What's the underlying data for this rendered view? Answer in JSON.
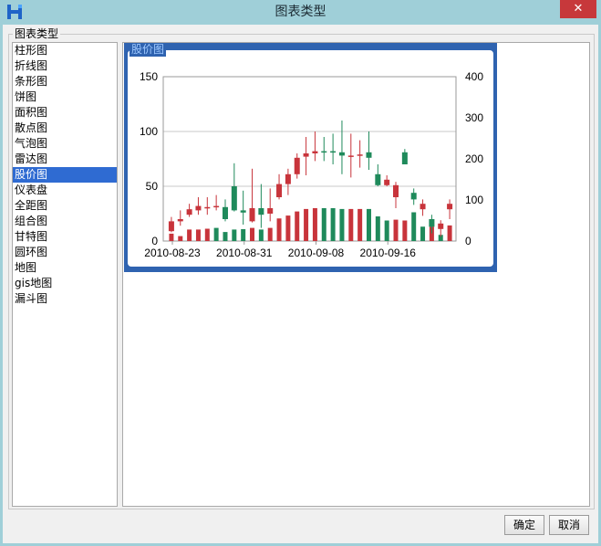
{
  "window": {
    "title": "图表类型",
    "close_symbol": "✕"
  },
  "group": {
    "label": "图表类型"
  },
  "chart_types": [
    {
      "label": "柱形图"
    },
    {
      "label": "折线图"
    },
    {
      "label": "条形图"
    },
    {
      "label": "饼图"
    },
    {
      "label": "面积图"
    },
    {
      "label": "散点图"
    },
    {
      "label": "气泡图"
    },
    {
      "label": "雷达图"
    },
    {
      "label": "股价图",
      "selected": true
    },
    {
      "label": "仪表盘"
    },
    {
      "label": "全距图"
    },
    {
      "label": "组合图"
    },
    {
      "label": "甘特图"
    },
    {
      "label": "圆环图"
    },
    {
      "label": "地图"
    },
    {
      "label": "gis地图"
    },
    {
      "label": "漏斗图"
    }
  ],
  "preview": {
    "label": "股价图"
  },
  "chart_data": {
    "type": "candlestick",
    "x_tick_labels": [
      "2010-08-23",
      "2010-08-31",
      "2010-09-08",
      "2010-09-16"
    ],
    "y_left": {
      "min": 0,
      "max": 150,
      "ticks": [
        0,
        50,
        100,
        150
      ]
    },
    "y_right": {
      "min": 0,
      "max": 400,
      "ticks": [
        0,
        100,
        200,
        300,
        400
      ]
    },
    "up_color": "#c8343b",
    "down_color": "#1f8a5b",
    "grid": true,
    "candles": [
      {
        "o": 9,
        "c": 18,
        "h": 22,
        "l": 8,
        "up": true
      },
      {
        "o": 18,
        "c": 20,
        "h": 28,
        "l": 14,
        "up": true
      },
      {
        "o": 24,
        "c": 29,
        "h": 34,
        "l": 22,
        "up": true
      },
      {
        "o": 28,
        "c": 32,
        "h": 40,
        "l": 24,
        "up": true
      },
      {
        "o": 30,
        "c": 31,
        "h": 40,
        "l": 24,
        "up": true
      },
      {
        "o": 31,
        "c": 32,
        "h": 42,
        "l": 28,
        "up": true
      },
      {
        "o": 31,
        "c": 20,
        "h": 38,
        "l": 18,
        "up": false
      },
      {
        "o": 50,
        "c": 28,
        "h": 71,
        "l": 27,
        "up": false
      },
      {
        "o": 28,
        "c": 26,
        "h": 46,
        "l": 15,
        "up": false
      },
      {
        "o": 18,
        "c": 30,
        "h": 66,
        "l": 17,
        "up": true
      },
      {
        "o": 30,
        "c": 24,
        "h": 52,
        "l": 12,
        "up": false
      },
      {
        "o": 25,
        "c": 30,
        "h": 48,
        "l": 18,
        "up": true
      },
      {
        "o": 40,
        "c": 52,
        "h": 61,
        "l": 38,
        "up": true
      },
      {
        "o": 52,
        "c": 61,
        "h": 66,
        "l": 42,
        "up": true
      },
      {
        "o": 61,
        "c": 76,
        "h": 80,
        "l": 57,
        "up": true
      },
      {
        "o": 77,
        "c": 80,
        "h": 95,
        "l": 60,
        "up": true
      },
      {
        "o": 80,
        "c": 82,
        "h": 100,
        "l": 73,
        "up": true
      },
      {
        "o": 82,
        "c": 82,
        "h": 95,
        "l": 73,
        "up": false
      },
      {
        "o": 82,
        "c": 81,
        "h": 98,
        "l": 70,
        "up": false
      },
      {
        "o": 81,
        "c": 78,
        "h": 110,
        "l": 61,
        "up": false
      },
      {
        "o": 77,
        "c": 78,
        "h": 98,
        "l": 58,
        "up": true
      },
      {
        "o": 78,
        "c": 79,
        "h": 92,
        "l": 67,
        "up": true
      },
      {
        "o": 81,
        "c": 76,
        "h": 100,
        "l": 65,
        "up": false
      },
      {
        "o": 61,
        "c": 51,
        "h": 70,
        "l": 50,
        "up": false
      },
      {
        "o": 51,
        "c": 56,
        "h": 60,
        "l": 50,
        "up": true
      },
      {
        "o": 40,
        "c": 51,
        "h": 54,
        "l": 30,
        "up": true
      },
      {
        "o": 81,
        "c": 70,
        "h": 84,
        "l": 70,
        "up": false
      },
      {
        "o": 44,
        "c": 38,
        "h": 48,
        "l": 33,
        "up": false
      },
      {
        "o": 29,
        "c": 34,
        "h": 38,
        "l": 23,
        "up": true
      },
      {
        "o": 20,
        "c": 13,
        "h": 24,
        "l": 7,
        "up": false
      },
      {
        "o": 11,
        "c": 16,
        "h": 19,
        "l": 4,
        "up": true
      },
      {
        "o": 29,
        "c": 34,
        "h": 38,
        "l": 20,
        "up": true
      }
    ],
    "volumes": [
      {
        "v": 18,
        "up": true
      },
      {
        "v": 12,
        "up": true
      },
      {
        "v": 28,
        "up": true
      },
      {
        "v": 28,
        "up": true
      },
      {
        "v": 30,
        "up": true
      },
      {
        "v": 32,
        "up": false
      },
      {
        "v": 22,
        "up": false
      },
      {
        "v": 28,
        "up": false
      },
      {
        "v": 29,
        "up": false
      },
      {
        "v": 32,
        "up": true
      },
      {
        "v": 28,
        "up": false
      },
      {
        "v": 32,
        "up": true
      },
      {
        "v": 55,
        "up": true
      },
      {
        "v": 62,
        "up": true
      },
      {
        "v": 72,
        "up": true
      },
      {
        "v": 78,
        "up": true
      },
      {
        "v": 80,
        "up": true
      },
      {
        "v": 80,
        "up": false
      },
      {
        "v": 80,
        "up": false
      },
      {
        "v": 78,
        "up": false
      },
      {
        "v": 78,
        "up": true
      },
      {
        "v": 78,
        "up": true
      },
      {
        "v": 78,
        "up": false
      },
      {
        "v": 60,
        "up": false
      },
      {
        "v": 50,
        "up": false
      },
      {
        "v": 52,
        "up": true
      },
      {
        "v": 50,
        "up": true
      },
      {
        "v": 70,
        "up": false
      },
      {
        "v": 35,
        "up": false
      },
      {
        "v": 35,
        "up": true
      },
      {
        "v": 15,
        "up": false
      },
      {
        "v": 38,
        "up": true
      }
    ]
  },
  "buttons": {
    "ok": "确定",
    "cancel": "取消"
  }
}
